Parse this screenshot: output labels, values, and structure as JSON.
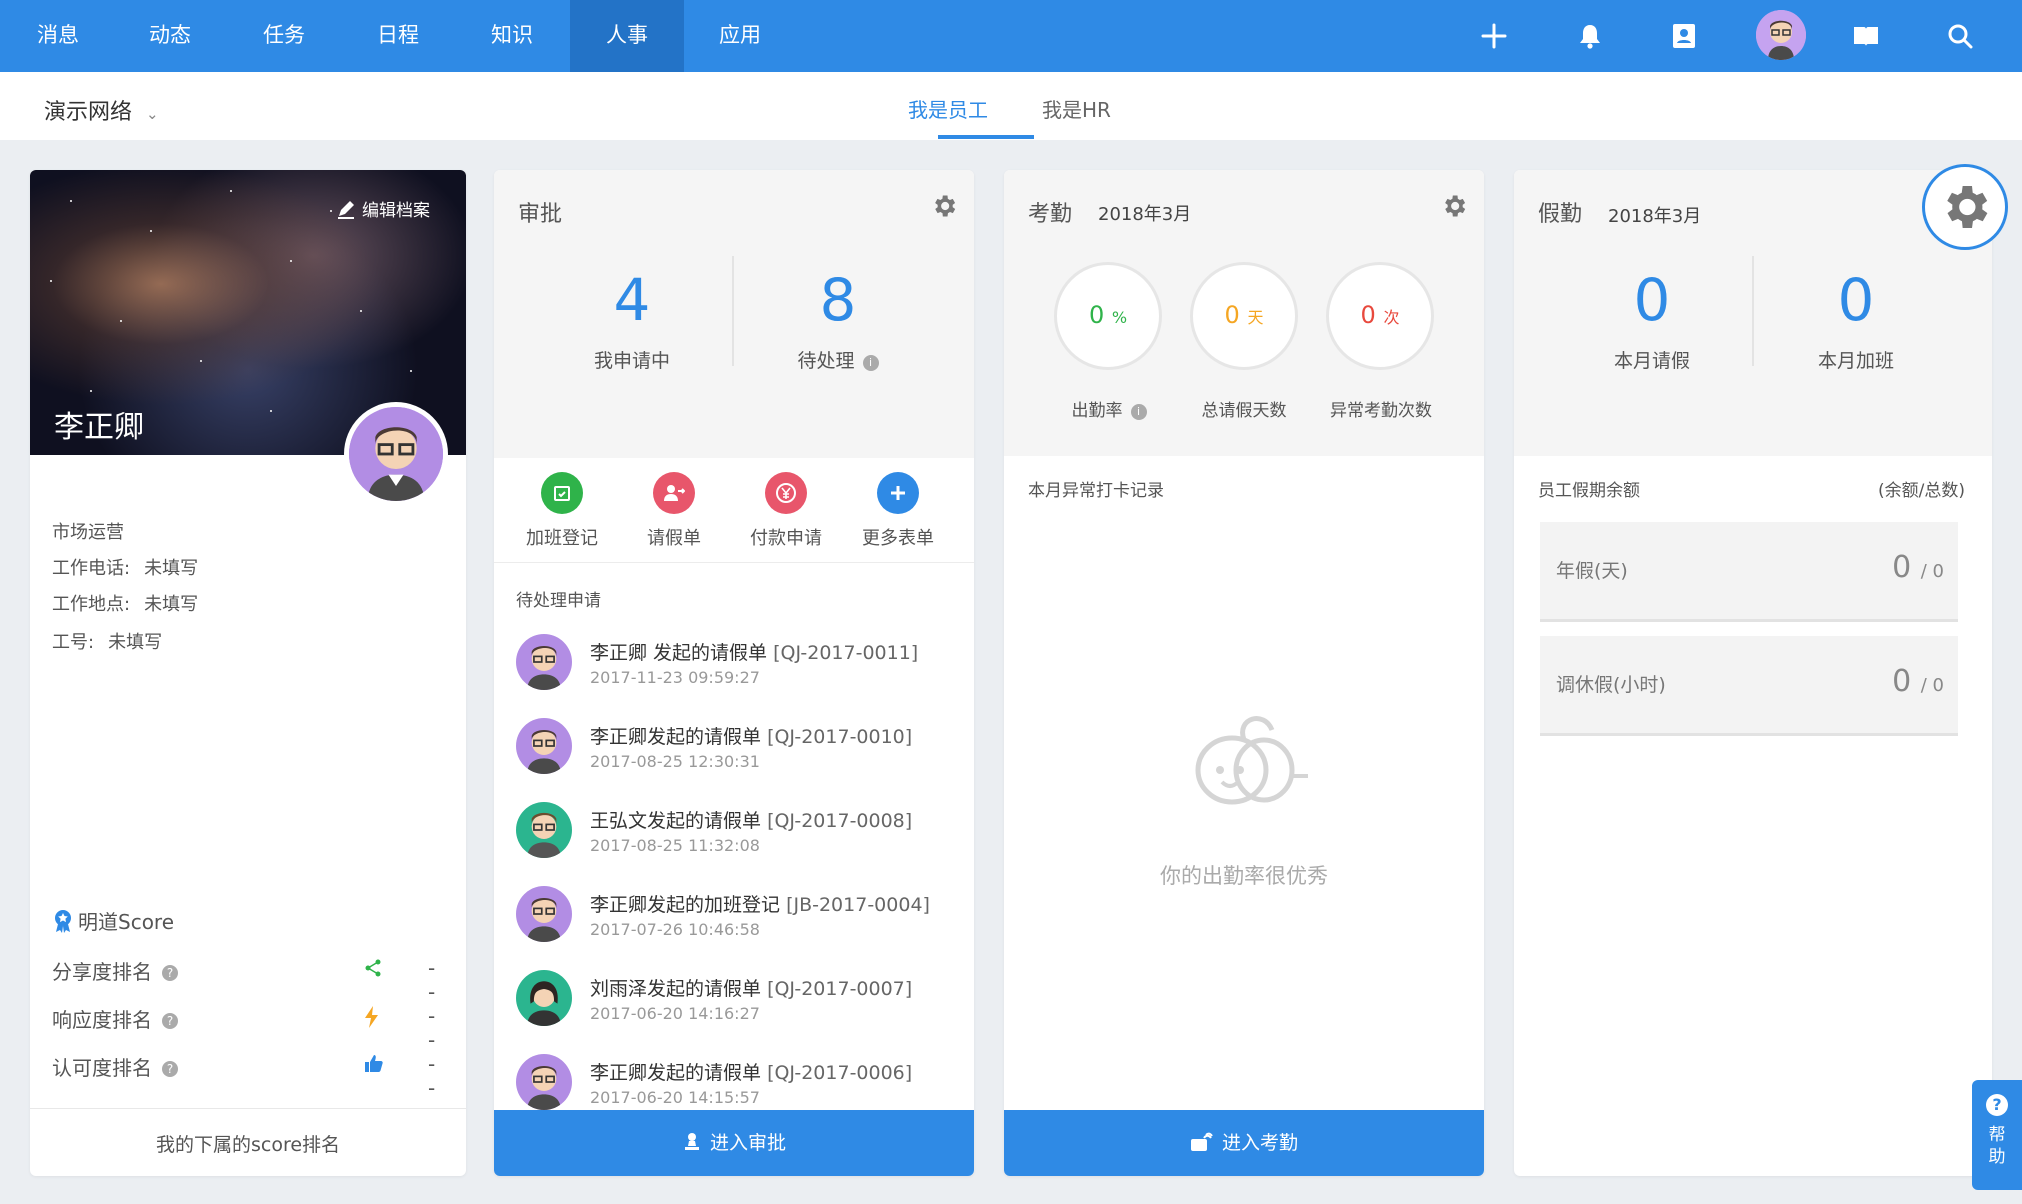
{
  "nav": {
    "tabs": [
      "消息",
      "动态",
      "任务",
      "日程",
      "知识",
      "人事",
      "应用"
    ],
    "active": "人事",
    "icons": [
      "plus-icon",
      "bell-icon",
      "contacts-icon",
      "avatar",
      "book-icon",
      "search-icon"
    ]
  },
  "subbar": {
    "network": "演示网络",
    "tabs": [
      "我是员工",
      "我是HR"
    ]
  },
  "profile": {
    "edit": "编辑档案",
    "name": "李正卿",
    "department": "市场运营",
    "phone_key": "工作电话:",
    "phone_val": "未填写",
    "location_key": "工作地点:",
    "location_val": "未填写",
    "id_key": "工号:",
    "id_val": "未填写",
    "score_title": "明道Score",
    "score_rows": [
      {
        "label": "分享度排名",
        "value": "- -"
      },
      {
        "label": "响应度排名",
        "value": "- -"
      },
      {
        "label": "认可度排名",
        "value": "- -"
      }
    ],
    "footer": "我的下属的score排名"
  },
  "approval": {
    "title": "审批",
    "applying_num": "4",
    "applying_label": "我申请中",
    "pending_num": "8",
    "pending_label": "待处理",
    "forms": [
      "加班登记",
      "请假单",
      "付款申请",
      "更多表单"
    ],
    "list_title": "待处理申请",
    "items": [
      {
        "title": "李正卿 发起的请假单",
        "code": "[QJ-2017-0011]",
        "date": "2017-11-23 09:59:27"
      },
      {
        "title": "李正卿发起的请假单",
        "code": "[QJ-2017-0010]",
        "date": "2017-08-25 12:30:31"
      },
      {
        "title": "王弘文发起的请假单",
        "code": "[QJ-2017-0008]",
        "date": "2017-08-25 11:32:08"
      },
      {
        "title": "李正卿发起的加班登记",
        "code": "[JB-2017-0004]",
        "date": "2017-07-26 10:46:58"
      },
      {
        "title": "刘雨泽发起的请假单",
        "code": "[QJ-2017-0007]",
        "date": "2017-06-20 14:16:27"
      },
      {
        "title": "李正卿发起的请假单",
        "code": "[QJ-2017-0006]",
        "date": "2017-06-20 14:15:57"
      }
    ],
    "button": "进入审批"
  },
  "attendance": {
    "title": "考勤",
    "month": "2018年3月",
    "rings": [
      {
        "num": "0",
        "unit": "%",
        "label": "出勤率",
        "color": "#2fb34a"
      },
      {
        "num": "0",
        "unit": "天",
        "label": "总请假天数",
        "color": "#f5a623"
      },
      {
        "num": "0",
        "unit": "次",
        "label": "异常考勤次数",
        "color": "#e8493d"
      }
    ],
    "record_title": "本月异常打卡记录",
    "empty_text": "你的出勤率很优秀",
    "button": "进入考勤"
  },
  "leave": {
    "title": "假勤",
    "month": "2018年3月",
    "month_leave_num": "0",
    "month_leave_label": "本月请假",
    "month_overtime_num": "0",
    "month_overtime_label": "本月加班",
    "balance_title": "员工假期余额",
    "balance_hint": "(余额/总数)",
    "balances": [
      {
        "name": "年假(天)",
        "remain": "0",
        "total": "/ 0"
      },
      {
        "name": "调休假(小时)",
        "remain": "0",
        "total": "/ 0"
      }
    ]
  },
  "help": {
    "label": "帮助"
  },
  "colors": {
    "primary": "#2f8ae5",
    "nav_active": "#2373c7"
  }
}
